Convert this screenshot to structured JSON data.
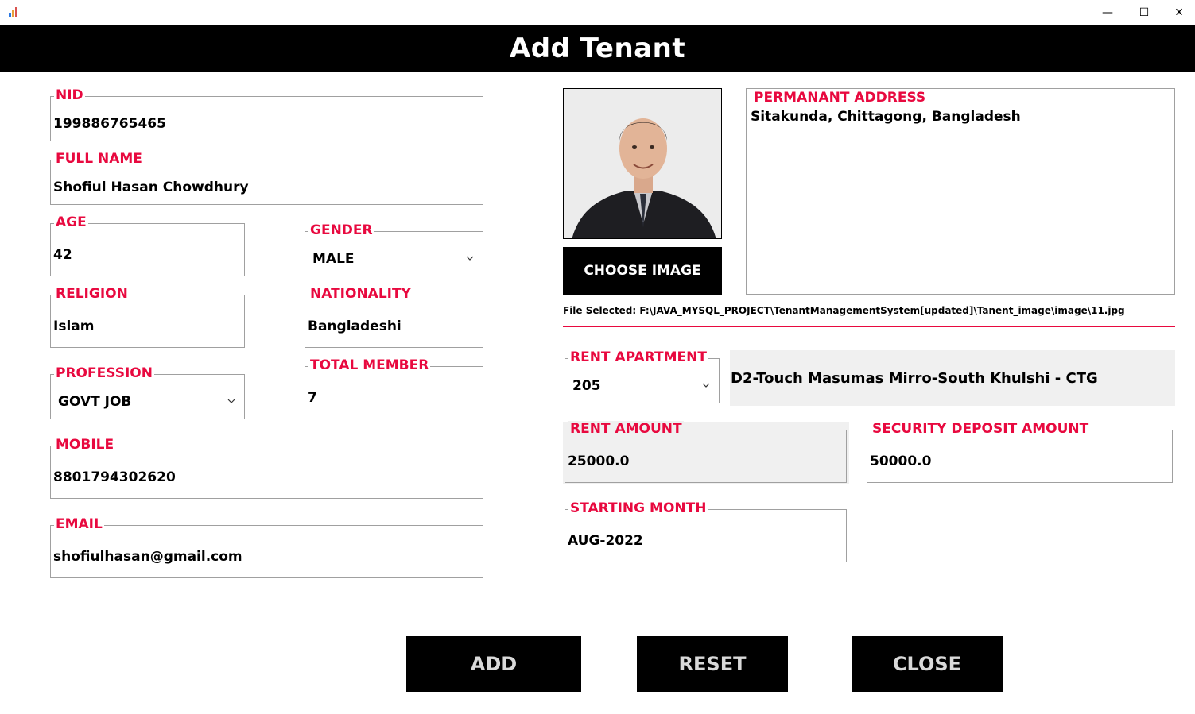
{
  "window": {
    "minimize_glyph": "—",
    "maximize_glyph": "☐",
    "close_glyph": "✕"
  },
  "header": {
    "title": "Add Tenant"
  },
  "form": {
    "nid": {
      "label": "NID",
      "value": "199886765465"
    },
    "full_name": {
      "label": "FULL NAME",
      "value": "Shofiul Hasan Chowdhury"
    },
    "age": {
      "label": "AGE",
      "value": "42"
    },
    "gender": {
      "label": "GENDER",
      "value": "MALE"
    },
    "religion": {
      "label": "RELIGION",
      "value": "Islam"
    },
    "nationality": {
      "label": "NATIONALITY",
      "value": "Bangladeshi"
    },
    "profession": {
      "label": "PROFESSION",
      "value": "GOVT JOB"
    },
    "total_member": {
      "label": "TOTAL MEMBER",
      "value": "7"
    },
    "mobile": {
      "label": "MOBILE",
      "value": "8801794302620"
    },
    "email": {
      "label": "EMAIL",
      "value": "shofiulhasan@gmail.com"
    }
  },
  "image": {
    "choose_label": "CHOOSE IMAGE",
    "file_selected": "File Selected: F:\\JAVA_MYSQL_PROJECT\\TenantManagementSystem[updated]\\Tanent_image\\image\\11.jpg"
  },
  "address": {
    "label": "PERMANANT ADDRESS",
    "value": "Sitakunda, Chittagong, Bangladesh"
  },
  "rent": {
    "apartment": {
      "label": "RENT APARTMENT",
      "value": "205"
    },
    "apartment_name": "D2-Touch Masumas Mirro-South Khulshi - CTG",
    "amount": {
      "label": "RENT AMOUNT",
      "value": "25000.0"
    },
    "security_deposit": {
      "label": "SECURITY DEPOSIT AMOUNT",
      "value": "50000.0"
    },
    "starting_month": {
      "label": "STARTING MONTH",
      "value": "AUG-2022"
    }
  },
  "actions": {
    "add_label": "ADD",
    "reset_label": "RESET",
    "close_label": "CLOSE"
  },
  "colors": {
    "label_red": "#e8093f",
    "header_bg": "#000000",
    "button_bg": "#000000",
    "button_text_grey": "#d9d9d9"
  }
}
